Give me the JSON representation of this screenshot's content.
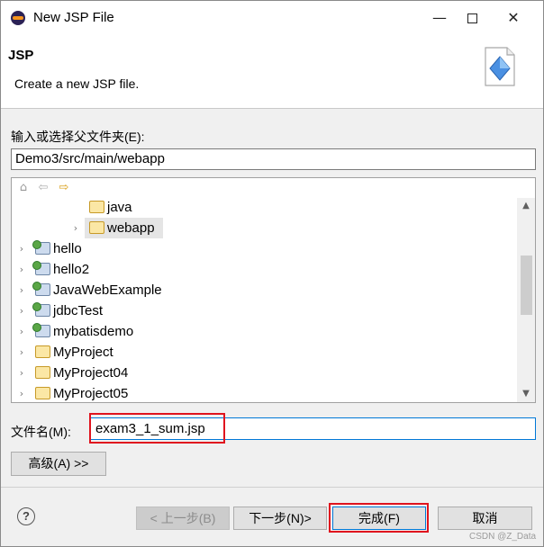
{
  "window": {
    "title": "New JSP File",
    "minimize_glyph": "—",
    "close_glyph": "✕"
  },
  "banner": {
    "title": "JSP",
    "description": "Create a new JSP file."
  },
  "folder": {
    "label": "输入或选择父文件夹(E):",
    "value": "Demo3/src/main/webapp"
  },
  "tree": {
    "toolbar_icons": [
      "home-icon",
      "back-arrow-icon",
      "forward-arrow-icon"
    ],
    "items": [
      {
        "label": "java",
        "icon": "folder-icon",
        "expandable": false
      },
      {
        "label": "webapp",
        "icon": "folder-icon",
        "expandable": true,
        "selected": true
      },
      {
        "label": "hello",
        "icon": "project-icon",
        "expandable": true
      },
      {
        "label": "hello2",
        "icon": "project-icon",
        "expandable": true
      },
      {
        "label": "JavaWebExample",
        "icon": "project-icon",
        "expandable": true
      },
      {
        "label": "jdbcTest",
        "icon": "project-icon",
        "expandable": true
      },
      {
        "label": "mybatisdemo",
        "icon": "project-icon",
        "expandable": true
      },
      {
        "label": "MyProject",
        "icon": "project-icon",
        "expandable": true
      },
      {
        "label": "MyProject04",
        "icon": "project-icon",
        "expandable": true
      },
      {
        "label": "MyProject05",
        "icon": "project-icon",
        "expandable": true
      }
    ]
  },
  "filename": {
    "label": "文件名(M):",
    "value": "exam3_1_sum.jsp"
  },
  "advanced_button": "高级(A) >>",
  "buttons": {
    "back": "< 上一步(B)",
    "next": "下一步(N)>",
    "finish": "完成(F)",
    "cancel": "取消"
  },
  "help_glyph": "?",
  "watermark": "CSDN @Z_Data",
  "colors": {
    "highlight_box": "#e0141e",
    "focus_border": "#0078d7",
    "selection_bg": "#e5e5e5"
  }
}
